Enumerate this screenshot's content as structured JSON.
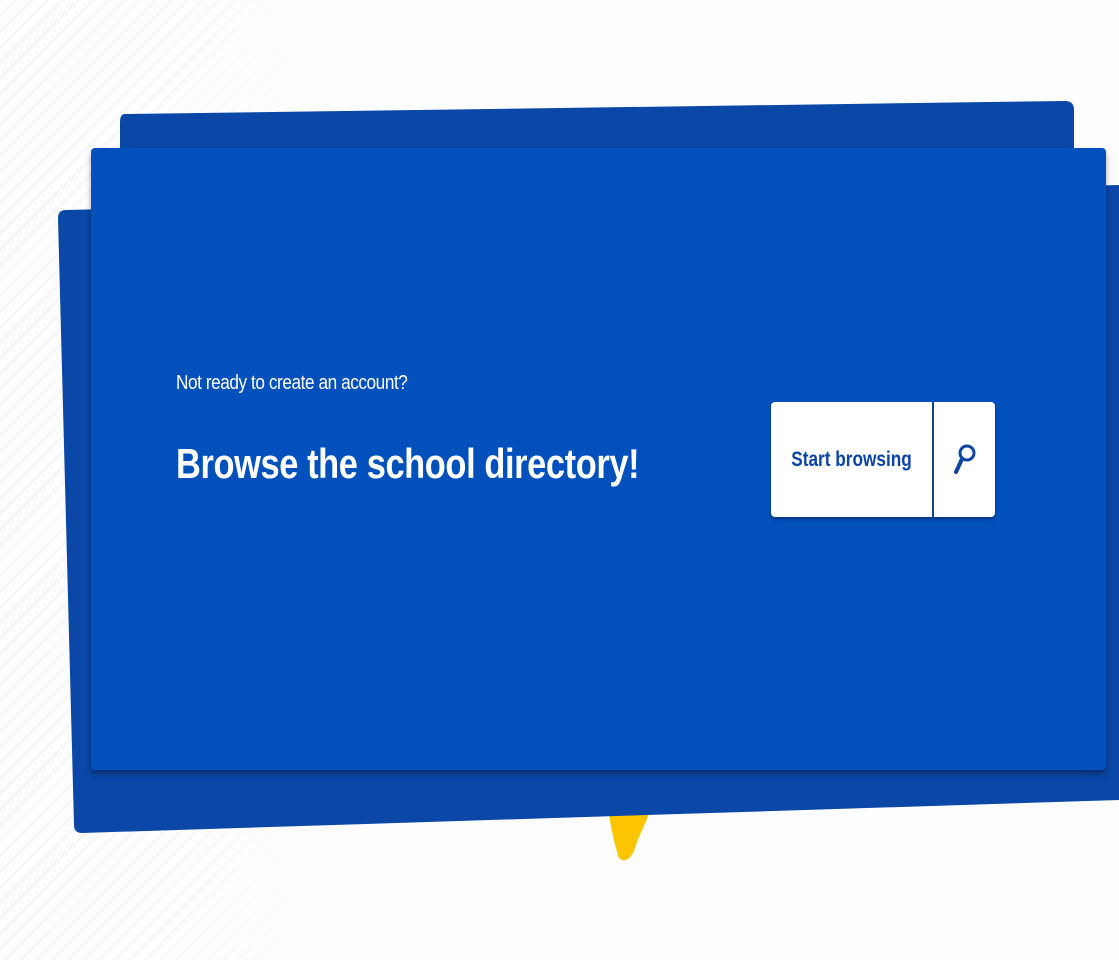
{
  "banner": {
    "prompt": "Not ready to create an account?",
    "headline": "Browse the school directory!",
    "button_label": "Start browsing",
    "button_icon": "search-icon"
  },
  "colors": {
    "card_blue": "#0250bb",
    "back_card_blue": "#0a47a7",
    "accent_yellow": "#fcc500",
    "button_text": "#0b44a5",
    "background": "#fdfdfd"
  }
}
